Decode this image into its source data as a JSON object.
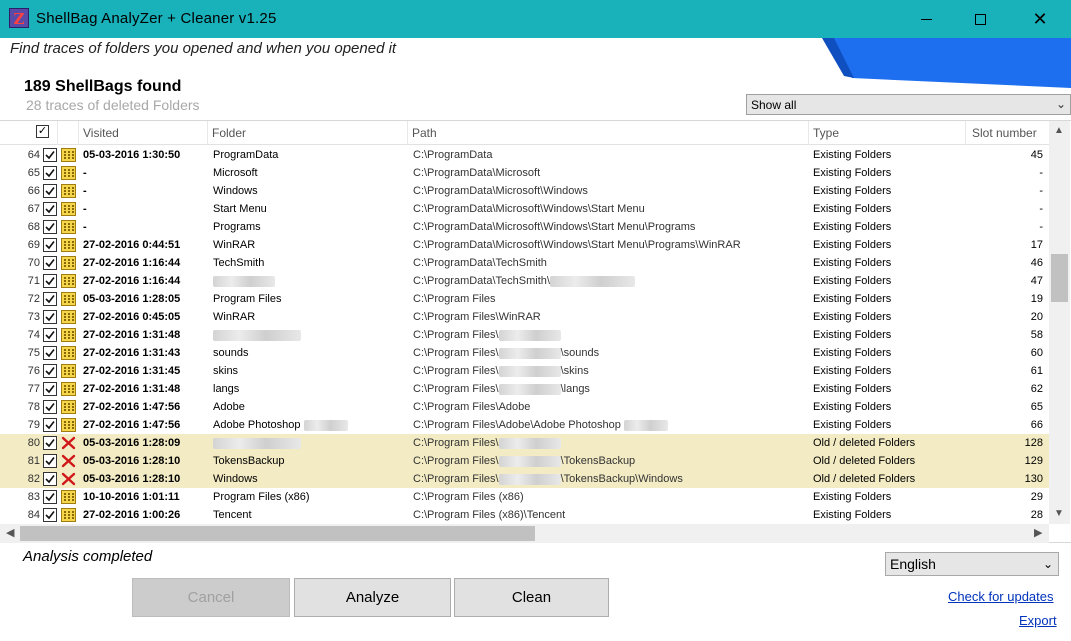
{
  "window": {
    "title": "ShellBag  AnalyZer + Cleaner v1.25",
    "icon_letter": "Z",
    "minimize": "minimize",
    "maximize": "maximize",
    "close": "✕"
  },
  "subtitle": "Find traces of folders you opened and when you opened it",
  "summary": {
    "found": "189 ShellBags found",
    "deleted": "28 traces of deleted Folders"
  },
  "filter": {
    "selected": "Show all"
  },
  "columns": {
    "visited": "Visited",
    "folder": "Folder",
    "path": "Path",
    "type": "Type",
    "slot": "Slot number"
  },
  "rows": [
    {
      "num": "64",
      "visited": "05-03-2016 1:30:50",
      "folder": "ProgramData",
      "path": "C:\\ProgramData",
      "type": "Existing Folders",
      "slot": "45",
      "deleted": false
    },
    {
      "num": "65",
      "visited": "-",
      "folder": "Microsoft",
      "path": "C:\\ProgramData\\Microsoft",
      "type": "Existing Folders",
      "slot": "-",
      "deleted": false
    },
    {
      "num": "66",
      "visited": "-",
      "folder": "Windows",
      "path": "C:\\ProgramData\\Microsoft\\Windows",
      "type": "Existing Folders",
      "slot": "-",
      "deleted": false
    },
    {
      "num": "67",
      "visited": "-",
      "folder": "Start Menu",
      "path": "C:\\ProgramData\\Microsoft\\Windows\\Start Menu",
      "type": "Existing Folders",
      "slot": "-",
      "deleted": false
    },
    {
      "num": "68",
      "visited": "-",
      "folder": "Programs",
      "path": "C:\\ProgramData\\Microsoft\\Windows\\Start Menu\\Programs",
      "type": "Existing Folders",
      "slot": "-",
      "deleted": false
    },
    {
      "num": "69",
      "visited": "27-02-2016 0:44:51",
      "folder": "WinRAR",
      "path": "C:\\ProgramData\\Microsoft\\Windows\\Start Menu\\Programs\\WinRAR",
      "type": "Existing Folders",
      "slot": "17",
      "deleted": false
    },
    {
      "num": "70",
      "visited": "27-02-2016 1:16:44",
      "folder": "TechSmith",
      "path": "C:\\ProgramData\\TechSmith",
      "type": "Existing Folders",
      "slot": "46",
      "deleted": false
    },
    {
      "num": "71",
      "visited": "27-02-2016 1:16:44",
      "folder": "",
      "path": "C:\\ProgramData\\TechSmith\\",
      "type": "Existing Folders",
      "slot": "47",
      "deleted": false
    },
    {
      "num": "72",
      "visited": "05-03-2016 1:28:05",
      "folder": "Program Files",
      "path": "C:\\Program Files",
      "type": "Existing Folders",
      "slot": "19",
      "deleted": false
    },
    {
      "num": "73",
      "visited": "27-02-2016 0:45:05",
      "folder": "WinRAR",
      "path": "C:\\Program Files\\WinRAR",
      "type": "Existing Folders",
      "slot": "20",
      "deleted": false
    },
    {
      "num": "74",
      "visited": "27-02-2016 1:31:48",
      "folder": "",
      "path": "C:\\Program Files\\",
      "type": "Existing Folders",
      "slot": "58",
      "deleted": false
    },
    {
      "num": "75",
      "visited": "27-02-2016 1:31:43",
      "folder": "sounds",
      "path": "C:\\Program Files\\",
      "path_tail": "\\sounds",
      "type": "Existing Folders",
      "slot": "60",
      "deleted": false
    },
    {
      "num": "76",
      "visited": "27-02-2016 1:31:45",
      "folder": "skins",
      "path": "C:\\Program Files\\",
      "path_tail": "\\skins",
      "type": "Existing Folders",
      "slot": "61",
      "deleted": false
    },
    {
      "num": "77",
      "visited": "27-02-2016 1:31:48",
      "folder": "langs",
      "path": "C:\\Program Files\\",
      "path_tail": "\\langs",
      "type": "Existing Folders",
      "slot": "62",
      "deleted": false
    },
    {
      "num": "78",
      "visited": "27-02-2016 1:47:56",
      "folder": "Adobe",
      "path": "C:\\Program Files\\Adobe",
      "type": "Existing Folders",
      "slot": "65",
      "deleted": false
    },
    {
      "num": "79",
      "visited": "27-02-2016 1:47:56",
      "folder": "Adobe Photoshop",
      "path": "C:\\Program Files\\Adobe\\Adobe Photoshop",
      "type": "Existing Folders",
      "slot": "66",
      "deleted": false
    },
    {
      "num": "80",
      "visited": "05-03-2016 1:28:09",
      "folder": "",
      "path": "C:\\Program Files\\",
      "type": "Old / deleted Folders",
      "slot": "128",
      "deleted": true
    },
    {
      "num": "81",
      "visited": "05-03-2016 1:28:10",
      "folder": "TokensBackup",
      "path": "C:\\Program Files\\",
      "path_tail": "\\TokensBackup",
      "type": "Old / deleted Folders",
      "slot": "129",
      "deleted": true
    },
    {
      "num": "82",
      "visited": "05-03-2016 1:28:10",
      "folder": "Windows",
      "path": "C:\\Program Files\\",
      "path_tail": "\\TokensBackup\\Windows",
      "type": "Old / deleted Folders",
      "slot": "130",
      "deleted": true
    },
    {
      "num": "83",
      "visited": "10-10-2016 1:01:11",
      "folder": "Program Files (x86)",
      "path": "C:\\Program Files (x86)",
      "type": "Existing Folders",
      "slot": "29",
      "deleted": false
    },
    {
      "num": "84",
      "visited": "27-02-2016 1:00:26",
      "folder": "Tencent",
      "path": "C:\\Program Files (x86)\\Tencent",
      "type": "Existing Folders",
      "slot": "28",
      "deleted": false
    }
  ],
  "status": "Analysis completed",
  "language": {
    "selected": "English"
  },
  "buttons": {
    "cancel": "Cancel",
    "analyze": "Analyze",
    "clean": "Clean"
  },
  "links": {
    "updates": "Check for updates",
    "export": "Export"
  },
  "colors": {
    "titlebar": "#19b1ba",
    "deleted_row": "#f2ebc4",
    "accent_blue": "#1e6ff0",
    "link": "#0033bb"
  },
  "icons": {
    "row_existing": "folder-grid-icon",
    "row_deleted": "red-x-icon"
  }
}
